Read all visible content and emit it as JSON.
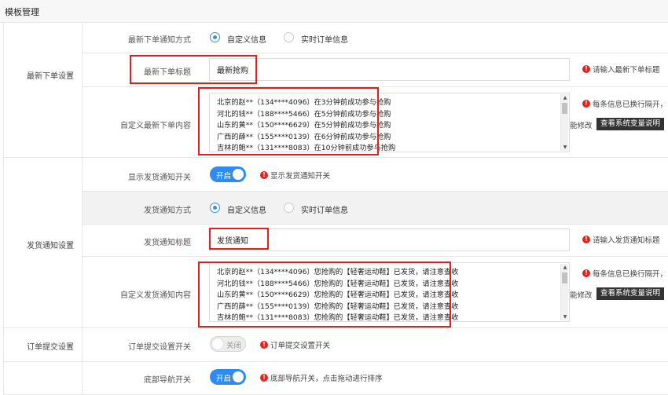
{
  "header": {
    "title": "模板管理"
  },
  "sections": {
    "latest_order": "最新下单设置",
    "shipping": "发货通知设置",
    "order_submit": "订单提交设置"
  },
  "rows": {
    "notify_method": {
      "label": "最新下单通知方式",
      "options": [
        "自定义信息",
        "实时订单信息"
      ],
      "selected": "自定义信息"
    },
    "latest_title": {
      "label": "最新下单标题",
      "value": "最新抢购",
      "hint": "请输入最新下单标题"
    },
    "latest_content": {
      "label": "自定义最新下单内容",
      "lines": [
        "北京的赵**（134****4096）在3分钟前成功参与抢购",
        "河北的钱**（188****5466）在5分钟前成功参与抢购",
        "山东的黄**（150****6629）在5分钟前成功参与抢购",
        "广西的薛**（155****0139）在6分钟前成功参与抢购",
        "吉林的鲍**（131****8083）在10分钟前成功参与抢购"
      ],
      "hint": "每条信息已换行隔开，",
      "hint_extra": "能修改",
      "help_button": "查看系统变量说明"
    },
    "show_shipping": {
      "label": "显示发货通知开关",
      "toggle": "开启",
      "hint": "显示发货通知开关"
    },
    "shipping_method": {
      "label": "发货通知方式",
      "options": [
        "自定义信息",
        "实时订单信息"
      ],
      "selected": "自定义信息"
    },
    "shipping_title": {
      "label": "发货通知标题",
      "value": "发货通知",
      "hint": "请输入发货通知标题"
    },
    "shipping_content": {
      "label": "自定义发货通知内容",
      "lines": [
        "北京的赵**（134****4096）您抢购的【轻奢运动鞋】已发货，请注意查收",
        "河北的钱**（188****5466）您抢购的【轻奢运动鞋】已发货，请注意查收",
        "山东的黄**（150****6629）您抢购的【轻奢运动鞋】已发货，请注意查收",
        "广西的薛**（155****0139）您抢购的【轻奢运动鞋】已发货，请注意查收",
        "吉林的鲍**（131****8083）您抢购的【轻奢运动鞋】已发货，请注意查收"
      ],
      "hint": "每条信息已换行隔开，",
      "hint_extra": "能修改",
      "help_button": "查看系统变量说明"
    },
    "order_submit": {
      "label": "订单提交设置开关",
      "toggle": "关闭",
      "hint": "订单提交设置开关"
    },
    "bottom_nav": {
      "label": "底部导航开关",
      "toggle": "开启",
      "hint": "底部导航开关，点击拖动进行排序"
    }
  },
  "colors": {
    "accent": "#2d8cf0",
    "warning": "#e8221b",
    "highlight_box": "#e02020"
  }
}
